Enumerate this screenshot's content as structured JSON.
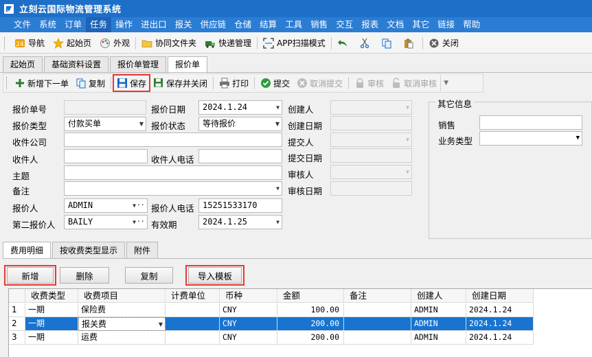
{
  "app": {
    "title": "立刻云国际物流管理系统"
  },
  "menu": [
    "文件",
    "系统",
    "订单",
    "任务",
    "操作",
    "进出口",
    "报关",
    "供应链",
    "仓储",
    "结算",
    "工具",
    "销售",
    "交互",
    "报表",
    "文档",
    "其它",
    "链接",
    "帮助"
  ],
  "menu_active": "任务",
  "quick_toolbar": {
    "nav": "导航",
    "home": "起始页",
    "look": "外观",
    "shared_folder": "协同文件夹",
    "express": "快递管理",
    "app_scan": "APP扫描模式",
    "close": "关闭"
  },
  "main_tabs": [
    "起始页",
    "基础资料设置",
    "报价单管理",
    "报价单"
  ],
  "main_tab_active": "报价单",
  "actions": {
    "add_next": "新增下一单",
    "copy": "复制",
    "save": "保存",
    "save_close": "保存并关闭",
    "print": "打印",
    "submit": "提交",
    "cancel_submit": "取消提交",
    "review": "审核",
    "cancel_review": "取消审核"
  },
  "form": {
    "quote_no_label": "报价单号",
    "quote_no": "",
    "quote_date_label": "报价日期",
    "quote_date": "2024.1.24",
    "creator_label": "创建人",
    "creator": "",
    "quote_type_label": "报价类型",
    "quote_type": "付款买单",
    "quote_status_label": "报价状态",
    "quote_status": "等待报价",
    "create_date_label": "创建日期",
    "create_date": "",
    "recv_company_label": "收件公司",
    "recv_company": "",
    "submitter_label": "提交人",
    "submitter": "",
    "receiver_label": "收件人",
    "receiver": "",
    "receiver_phone_label": "收件人电话",
    "receiver_phone": "",
    "submit_date_label": "提交日期",
    "submit_date": "",
    "subject_label": "主题",
    "subject": "",
    "reviewer_label": "审核人",
    "reviewer": "",
    "remark_label": "备注",
    "remark": "",
    "review_date_label": "审核日期",
    "review_date": "",
    "quoter_label": "报价人",
    "quoter": "ADMIN",
    "quoter_phone_label": "报价人电话",
    "quoter_phone": "15251533170",
    "second_quoter_label": "第二报价人",
    "second_quoter": "BAILY",
    "valid_until_label": "有效期",
    "valid_until": "2024.1.25"
  },
  "other_info": {
    "title": "其它信息",
    "sales_label": "销售",
    "sales": "",
    "biz_type_label": "业务类型",
    "biz_type": ""
  },
  "sub_tabs": [
    "费用明细",
    "按收费类型显示",
    "附件"
  ],
  "sub_tab_active": "费用明细",
  "grid_buttons": {
    "add": "新增",
    "delete": "删除",
    "copy": "复制",
    "import": "导入模板"
  },
  "grid": {
    "columns": [
      "收费类型",
      "收费项目",
      "计费单位",
      "币种",
      "金额",
      "备注",
      "创建人",
      "创建日期"
    ],
    "rows": [
      {
        "no": "1",
        "type": "一期",
        "item": "保险费",
        "unit": "",
        "currency": "CNY",
        "amount": "100.00",
        "remark": "",
        "creator": "ADMIN",
        "date": "2024.1.24"
      },
      {
        "no": "2",
        "type": "一期",
        "item": "报关费",
        "unit": "",
        "currency": "CNY",
        "amount": "200.00",
        "remark": "",
        "creator": "ADMIN",
        "date": "2024.1.24"
      },
      {
        "no": "3",
        "type": "一期",
        "item": "运费",
        "unit": "",
        "currency": "CNY",
        "amount": "200.00",
        "remark": "",
        "creator": "ADMIN",
        "date": "2024.1.24"
      }
    ],
    "selected_row": 2
  },
  "colors": {
    "title_bar": "#1e6fc7",
    "menu_bar": "#2b7cd3",
    "selection": "#1874d0",
    "highlight": "#e53935"
  }
}
